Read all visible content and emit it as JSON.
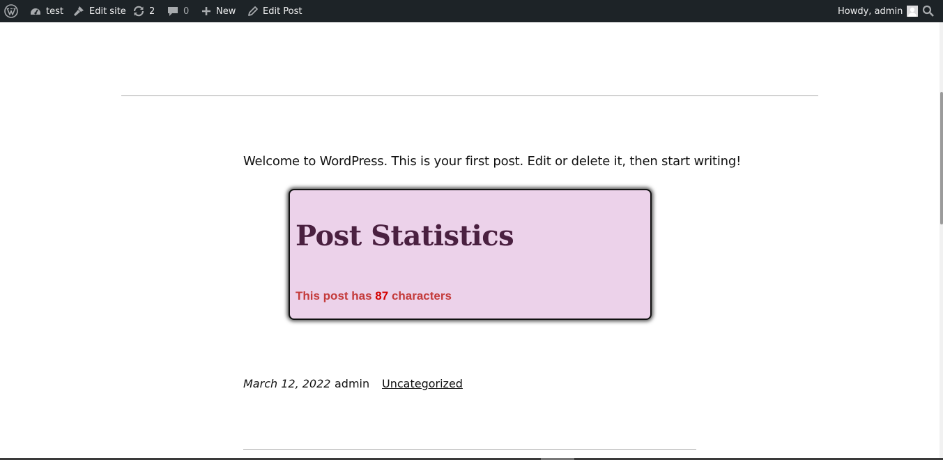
{
  "adminbar": {
    "wp_logo": "wordpress-logo-icon",
    "site_name": "test",
    "edit_site": "Edit site",
    "updates_count": "2",
    "comments_count": "0",
    "new_label": "New",
    "edit_post": "Edit Post",
    "greeting": "Howdy, admin"
  },
  "post": {
    "intro_text": "Welcome to WordPress. This is your first post. Edit or delete it, then start writing!",
    "stats": {
      "title": "Post Statistics",
      "prefix": "This post has ",
      "count": "87",
      "suffix": " characters"
    },
    "meta": {
      "date": "March 12, 2022",
      "author": "admin",
      "category": "Uncategorized"
    }
  },
  "colors": {
    "adminbar_bg": "#1d2327",
    "stats_bg": "#ecd2ea",
    "stats_title": "#4a2040",
    "stats_text": "#c43b3b"
  }
}
